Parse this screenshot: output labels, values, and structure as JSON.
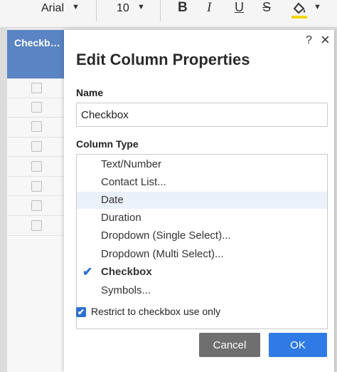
{
  "toolbar": {
    "font_name": "Arial",
    "font_size": "10",
    "bold_icon": "B",
    "italic_icon": "I",
    "underline_icon": "U",
    "strike_icon": "S",
    "caret": "▼",
    "fill_icon": "paint-bucket-icon",
    "fill_color": "#f2d500"
  },
  "grid": {
    "column_header": "Checkb…",
    "header_color": "#5a84c4"
  },
  "dialog": {
    "help_icon": "?",
    "close_icon": "×",
    "title": "Edit Column Properties",
    "name_label": "Name",
    "name_value": "Checkbox",
    "column_type_label": "Column Type",
    "column_types": [
      {
        "label": "Text/Number"
      },
      {
        "label": "Contact List..."
      },
      {
        "label": "Date"
      },
      {
        "label": "Duration"
      },
      {
        "label": "Dropdown (Single Select)..."
      },
      {
        "label": "Dropdown (Multi Select)..."
      },
      {
        "label": "Checkbox"
      },
      {
        "label": "Symbols..."
      }
    ],
    "selected_type": "Checkbox",
    "highlighted_type": "Date",
    "check_icon": "✔",
    "restrict_label": "Restrict to checkbox use only",
    "restrict_checked": true,
    "cancel_label": "Cancel",
    "ok_label": "OK",
    "accent_color": "#2f7ae5"
  }
}
